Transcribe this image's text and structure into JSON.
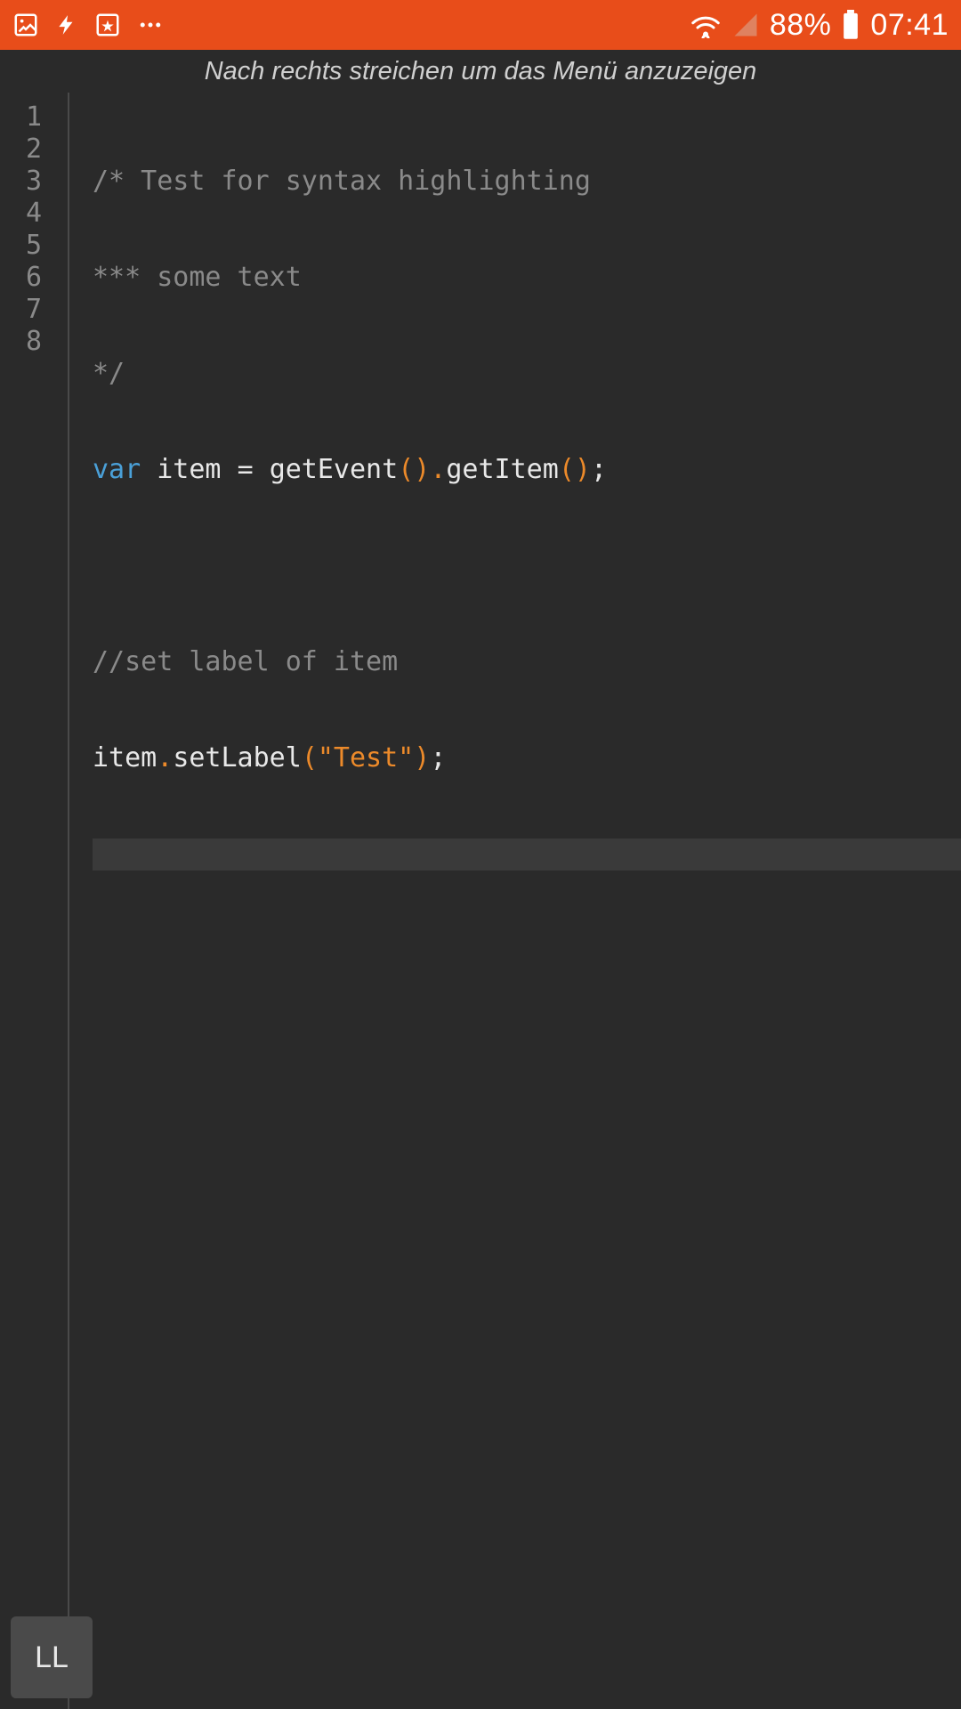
{
  "statusbar": {
    "battery_pct": "88%",
    "time": "07:41"
  },
  "hint": {
    "text": "Nach rechts streichen um das Menü anzuzeigen"
  },
  "gutter": {
    "lines": [
      "1",
      "2",
      "3",
      "4",
      "5",
      "6",
      "7",
      "8"
    ]
  },
  "code": {
    "l1": {
      "full": "/* Test for syntax highlighting"
    },
    "l2": {
      "full": "*** some text"
    },
    "l3": {
      "full": "*/"
    },
    "l4": {
      "kw": "var",
      "sp1": " ",
      "ident": "item",
      "sp2": " ",
      "eq": "=",
      "sp3": " ",
      "fn1": "getEvent",
      "po1": "(",
      "pc1": ")",
      "dot": ".",
      "fn2": "getItem",
      "po2": "(",
      "pc2": ")",
      "semi": ";"
    },
    "l6": {
      "full": "//set label of item"
    },
    "l7": {
      "obj": "item",
      "dot": ".",
      "fn": "setLabel",
      "po": "(",
      "str": "\"Test\"",
      "pc": ")",
      "semi": ";"
    }
  },
  "ll": {
    "label": "LL"
  }
}
